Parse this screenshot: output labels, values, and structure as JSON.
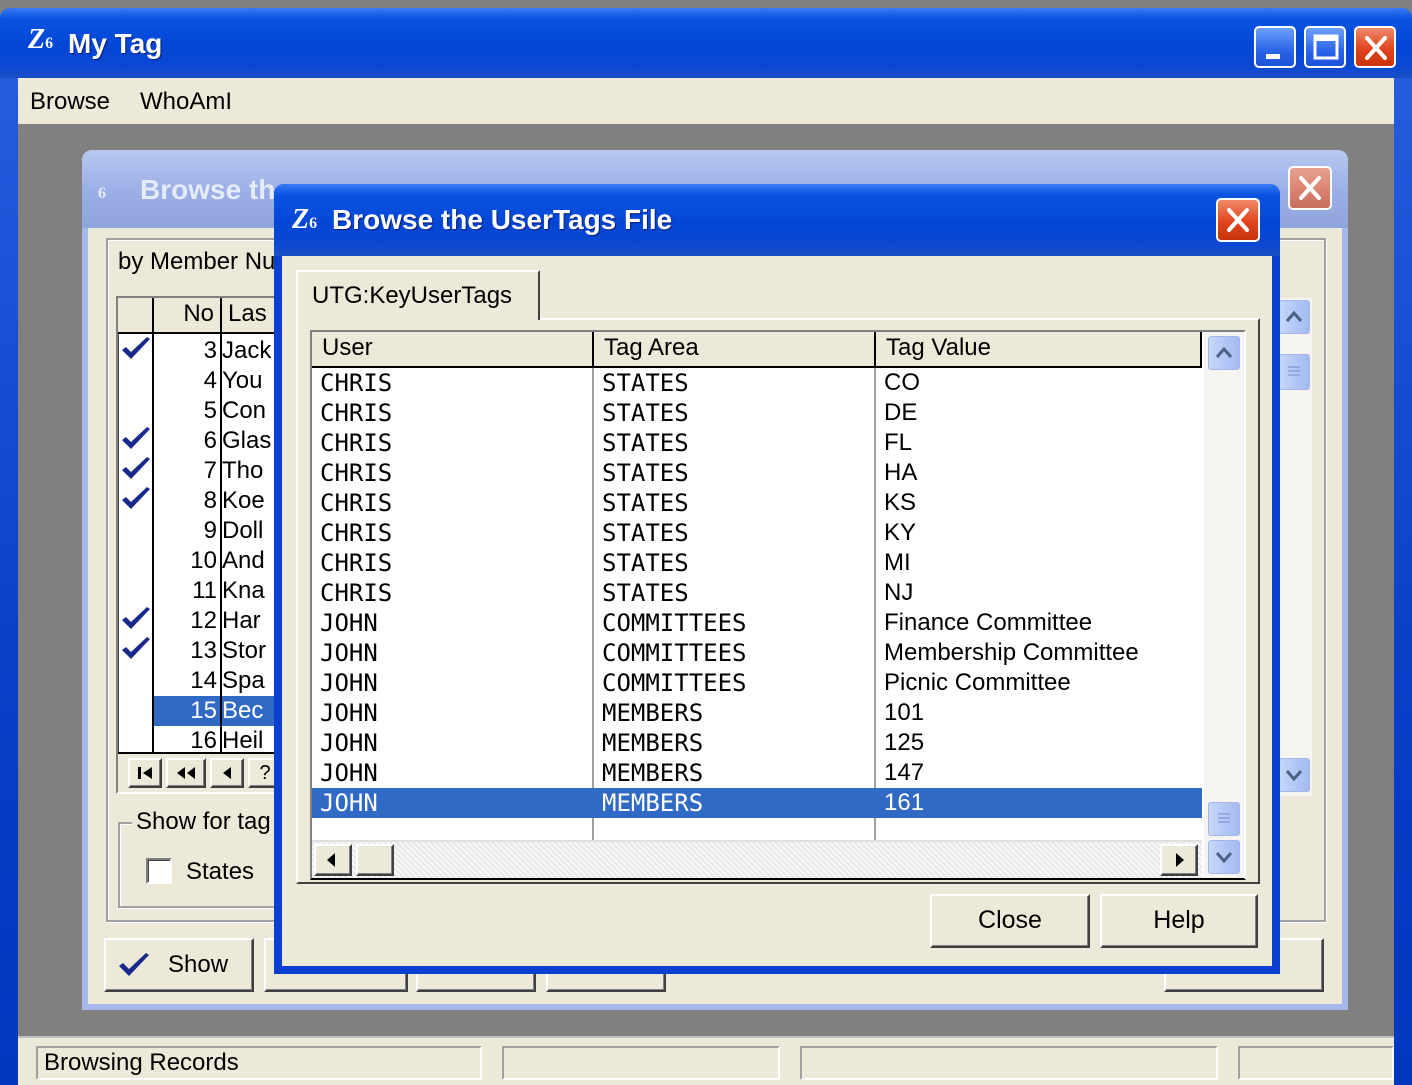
{
  "main_window": {
    "icon_text": "Z",
    "icon_sub": "6",
    "title": "My Tag",
    "menu": [
      {
        "label": "Browse"
      },
      {
        "label": "WhoAmI"
      }
    ],
    "status_panels": [
      "Browsing Records",
      "",
      "",
      "",
      ""
    ]
  },
  "background_window": {
    "title_visible": "Browse th",
    "tab_label_visible": "by Member Nu",
    "columns": [
      "No",
      "Las"
    ],
    "rows": [
      {
        "no": "3",
        "last": "Jack",
        "tagged": true
      },
      {
        "no": "4",
        "last": "You",
        "tagged": false
      },
      {
        "no": "5",
        "last": "Con",
        "tagged": false
      },
      {
        "no": "6",
        "last": "Glas",
        "tagged": true
      },
      {
        "no": "7",
        "last": "Tho",
        "tagged": true
      },
      {
        "no": "8",
        "last": "Koe",
        "tagged": true
      },
      {
        "no": "9",
        "last": "Doll",
        "tagged": false
      },
      {
        "no": "10",
        "last": "And",
        "tagged": false
      },
      {
        "no": "11",
        "last": "Kna",
        "tagged": false
      },
      {
        "no": "12",
        "last": "Har",
        "tagged": true
      },
      {
        "no": "13",
        "last": "Stor",
        "tagged": true
      },
      {
        "no": "14",
        "last": "Spa",
        "tagged": false
      },
      {
        "no": "15",
        "last": "Bec",
        "tagged": false,
        "selected": true
      },
      {
        "no": "16",
        "last": "Heil",
        "tagged": false
      }
    ],
    "nav_buttons": [
      "first",
      "prev-page",
      "prev",
      "?"
    ],
    "group_label_visible": "Show for tag",
    "states_checkbox_label": "States",
    "states_checked": false,
    "show_button_label": "Show"
  },
  "dialog": {
    "icon_text": "Z",
    "icon_sub": "6",
    "title": "Browse the UserTags File",
    "tab_label": "UTG:KeyUserTags",
    "columns": [
      "User",
      "Tag Area",
      "Tag Value"
    ],
    "rows": [
      {
        "user": "CHRIS",
        "area": "STATES",
        "value": "CO"
      },
      {
        "user": "CHRIS",
        "area": "STATES",
        "value": "DE"
      },
      {
        "user": "CHRIS",
        "area": "STATES",
        "value": "FL"
      },
      {
        "user": "CHRIS",
        "area": "STATES",
        "value": "HA"
      },
      {
        "user": "CHRIS",
        "area": "STATES",
        "value": "KS"
      },
      {
        "user": "CHRIS",
        "area": "STATES",
        "value": "KY"
      },
      {
        "user": "CHRIS",
        "area": "STATES",
        "value": "MI"
      },
      {
        "user": "CHRIS",
        "area": "STATES",
        "value": "NJ"
      },
      {
        "user": "JOHN",
        "area": "COMMITTEES",
        "value": "Finance Committee"
      },
      {
        "user": "JOHN",
        "area": "COMMITTEES",
        "value": "Membership Committee"
      },
      {
        "user": "JOHN",
        "area": "COMMITTEES",
        "value": "Picnic Committee"
      },
      {
        "user": "JOHN",
        "area": "MEMBERS",
        "value": "101"
      },
      {
        "user": "JOHN",
        "area": "MEMBERS",
        "value": "125"
      },
      {
        "user": "JOHN",
        "area": "MEMBERS",
        "value": "147"
      },
      {
        "user": "JOHN",
        "area": "MEMBERS",
        "value": "161",
        "selected": true
      }
    ],
    "close_button_label": "Close",
    "help_button_label": "Help"
  },
  "colors": {
    "xp_blue": "#0a54e3",
    "selection": "#316ac5",
    "face": "#ece9d8",
    "check": "#1a2a8a"
  }
}
